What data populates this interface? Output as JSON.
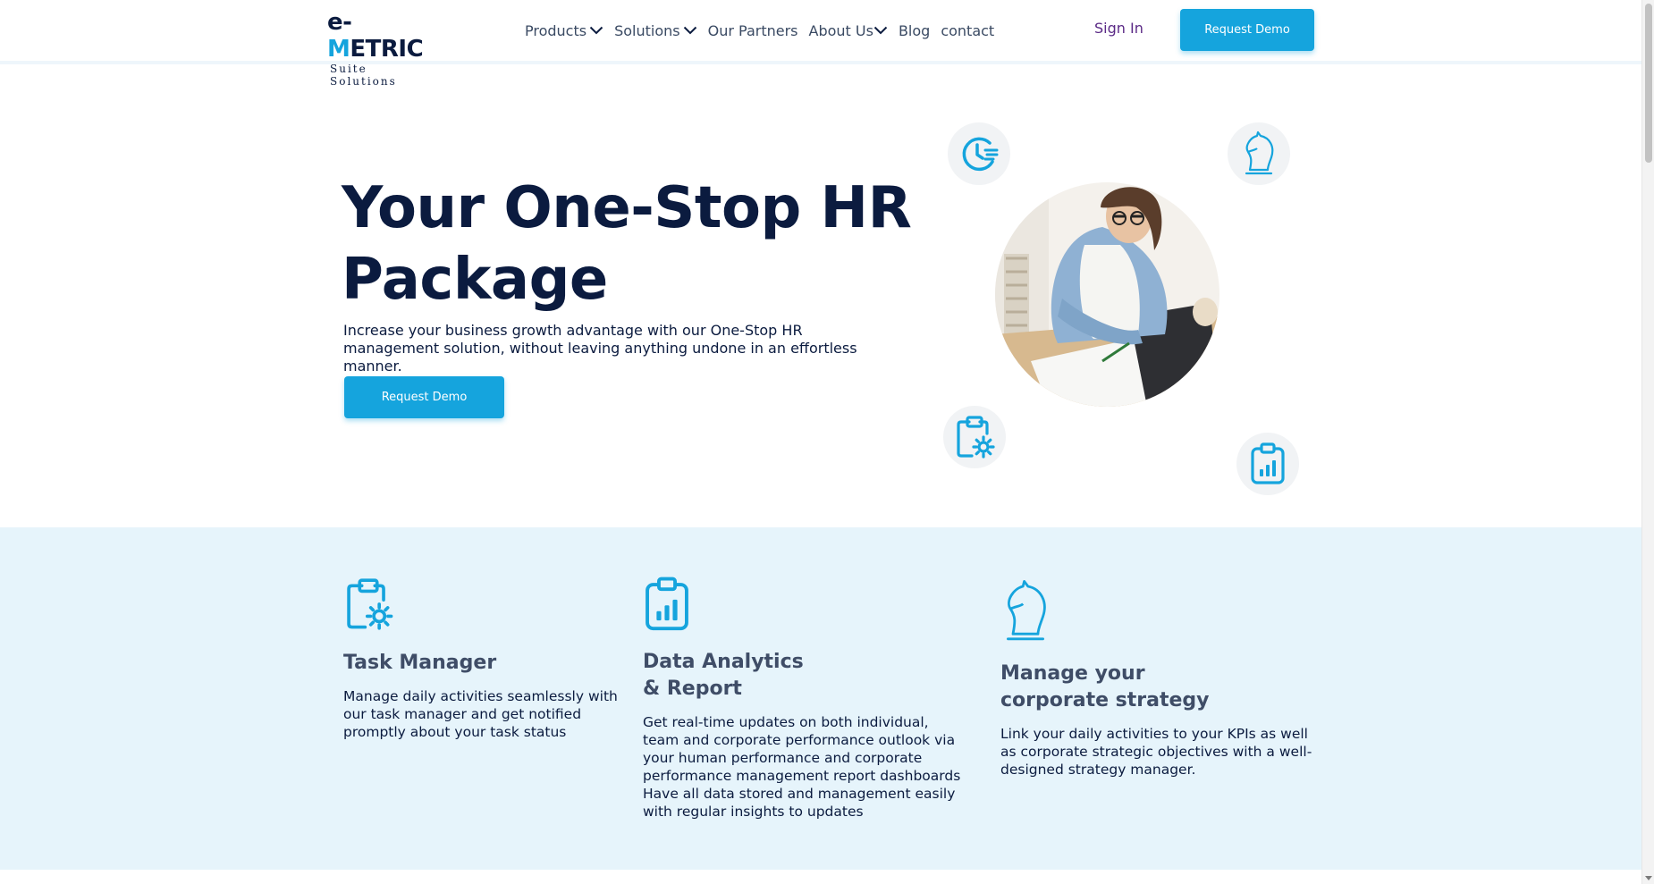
{
  "brand": {
    "logo_main_prefix": "e-",
    "logo_main_accent": "M",
    "logo_main_rest": "ETRIC",
    "logo_sub": "Suite Solutions",
    "accent_color": "#15a4dd",
    "navy_color": "#0b1b3f"
  },
  "nav": {
    "items": [
      {
        "label": "Products",
        "has_dropdown": true
      },
      {
        "label": "Solutions",
        "has_dropdown": true
      },
      {
        "label": "Our Partners",
        "has_dropdown": false
      },
      {
        "label": "About Us",
        "has_dropdown": true
      },
      {
        "label": "Blog",
        "has_dropdown": false
      },
      {
        "label": "contact",
        "has_dropdown": false
      }
    ],
    "sign_in": "Sign In",
    "request_demo": "Request Demo"
  },
  "hero": {
    "title": "Your One-Stop HR Package",
    "subtitle": "Increase your business growth advantage with our One-Stop HR management solution, without leaving anything undone in an effortless manner.",
    "cta": "Request Demo",
    "photo_icon": "woman-writing-photo",
    "floating_icons": [
      "clock-list-icon",
      "chess-knight-icon",
      "clipboard-gear-icon",
      "clipboard-chart-icon"
    ]
  },
  "features": [
    {
      "icon": "clipboard-gear-icon",
      "title": "Task Manager",
      "description": "Manage daily activities seamlessly with our task manager and get notified promptly about your task status"
    },
    {
      "icon": "clipboard-chart-icon",
      "title": "Data Analytics & Report",
      "description": "Get real-time updates on both individual, team and corporate performance outlook via your human performance and corporate performance management report dashboards Have all data stored and management easily with regular insights to updates"
    },
    {
      "icon": "chess-knight-icon",
      "title": "Manage your corporate strategy",
      "description": "Link your daily activities to your KPIs as well as corporate strategic objectives with a well-designed strategy manager."
    }
  ]
}
